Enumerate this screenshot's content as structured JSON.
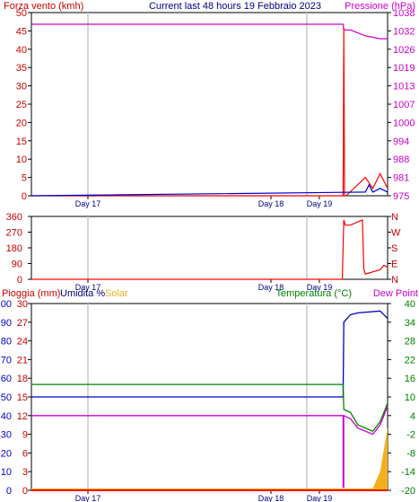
{
  "chart_data": [
    {
      "type": "line",
      "title": "Current last 48 hours 19 Febbraio 2023",
      "left_label": "Forza vento (kmh)",
      "right_label": "Pressione (hPa)",
      "x_ticks": [
        "Day 17",
        "Day 18",
        "Day 19"
      ],
      "y_left_ticks": [
        "0",
        "5",
        "10",
        "15",
        "20",
        "25",
        "30",
        "35",
        "40",
        "45",
        "50"
      ],
      "y_right_ticks": [
        "975",
        "981",
        "988",
        "994",
        "1000",
        "1007",
        "1013",
        "1019",
        "1026",
        "1032",
        "1038"
      ],
      "y_left_range": [
        0,
        50
      ],
      "y_right_range": [
        975,
        1038
      ],
      "series": [
        {
          "color": "#cc00cc",
          "axis": "right",
          "x": [
            0,
            42,
            42.1,
            43,
            45,
            47,
            48
          ],
          "y": [
            1034,
            1034,
            1032,
            1032,
            1030,
            1029,
            1029
          ]
        },
        {
          "color": "#ff0000",
          "axis": "left",
          "x": [
            0,
            42,
            42.1,
            42.2,
            42.4,
            45,
            46,
            47,
            47.5,
            48
          ],
          "y": [
            0,
            0,
            46,
            0,
            0,
            5,
            2,
            6,
            4,
            2
          ]
        },
        {
          "color": "#0000cc",
          "axis": "left",
          "x": [
            0,
            45,
            45.5,
            46,
            47,
            48
          ],
          "y": [
            0,
            1,
            3,
            1,
            2,
            1
          ]
        }
      ]
    },
    {
      "type": "line",
      "x_ticks": [
        "Day 17",
        "Day 18",
        "Day 19"
      ],
      "y_left_ticks": [
        "0",
        "90",
        "180",
        "270",
        "360"
      ],
      "y_right_ticks": [
        "N",
        "E",
        "S",
        "W",
        "N"
      ],
      "y_left_range": [
        0,
        360
      ],
      "series": [
        {
          "color": "#ff0000",
          "x": [
            0,
            41.9,
            42.1,
            42.3,
            43,
            44.6,
            44.8,
            45,
            47,
            47.5,
            48
          ],
          "y": [
            0,
            0,
            340,
            310,
            310,
            340,
            60,
            30,
            55,
            80,
            70
          ]
        }
      ]
    },
    {
      "type": "line",
      "left_labels": [
        "Pioggia (mm)",
        "Umidita %",
        "Solar"
      ],
      "right_labels": [
        "Temperatura (°C)",
        "Dew Point"
      ],
      "x_ticks": [
        "Day 17",
        "Day 18",
        "Day 19"
      ],
      "y_left_ticks": [
        "0",
        "10",
        "20",
        "30",
        "40",
        "50",
        "60",
        "70",
        "80",
        "90",
        "100"
      ],
      "y_rain_ticks": [
        "0",
        "3",
        "6",
        "9",
        "12",
        "15",
        "18",
        "21",
        "24",
        "27",
        "30"
      ],
      "y_right_ticks": [
        "-20",
        "-14",
        "-8",
        "-2",
        "4",
        "10",
        "16",
        "22",
        "28",
        "34",
        "40"
      ],
      "y_right_range": [
        -20,
        40
      ],
      "y_left_range": [
        0,
        100
      ],
      "series": [
        {
          "color": "#0000cc",
          "axis": "left",
          "x": [
            0,
            42,
            42.1,
            43,
            44,
            47,
            48
          ],
          "y": [
            50,
            50,
            90,
            94,
            95,
            96,
            92
          ]
        },
        {
          "color": "#008000",
          "axis": "right",
          "x": [
            0,
            42,
            42.1,
            43,
            44,
            46,
            47,
            48
          ],
          "y": [
            14,
            14,
            6,
            5,
            1,
            -1,
            2,
            8
          ]
        },
        {
          "color": "#cc00cc",
          "axis": "right",
          "x": [
            0,
            42,
            42.1,
            43,
            44,
            46,
            47,
            48
          ],
          "y": [
            4,
            4,
            4,
            3,
            0,
            -2,
            1,
            7
          ]
        },
        {
          "color": "#ff0000",
          "axis": "rain",
          "x": [
            0,
            48
          ],
          "y": [
            0,
            0
          ]
        },
        {
          "color": "#f2b11c",
          "axis": "left",
          "x": [
            0,
            46,
            47,
            48
          ],
          "y": [
            1,
            1,
            10,
            34
          ]
        }
      ]
    }
  ]
}
